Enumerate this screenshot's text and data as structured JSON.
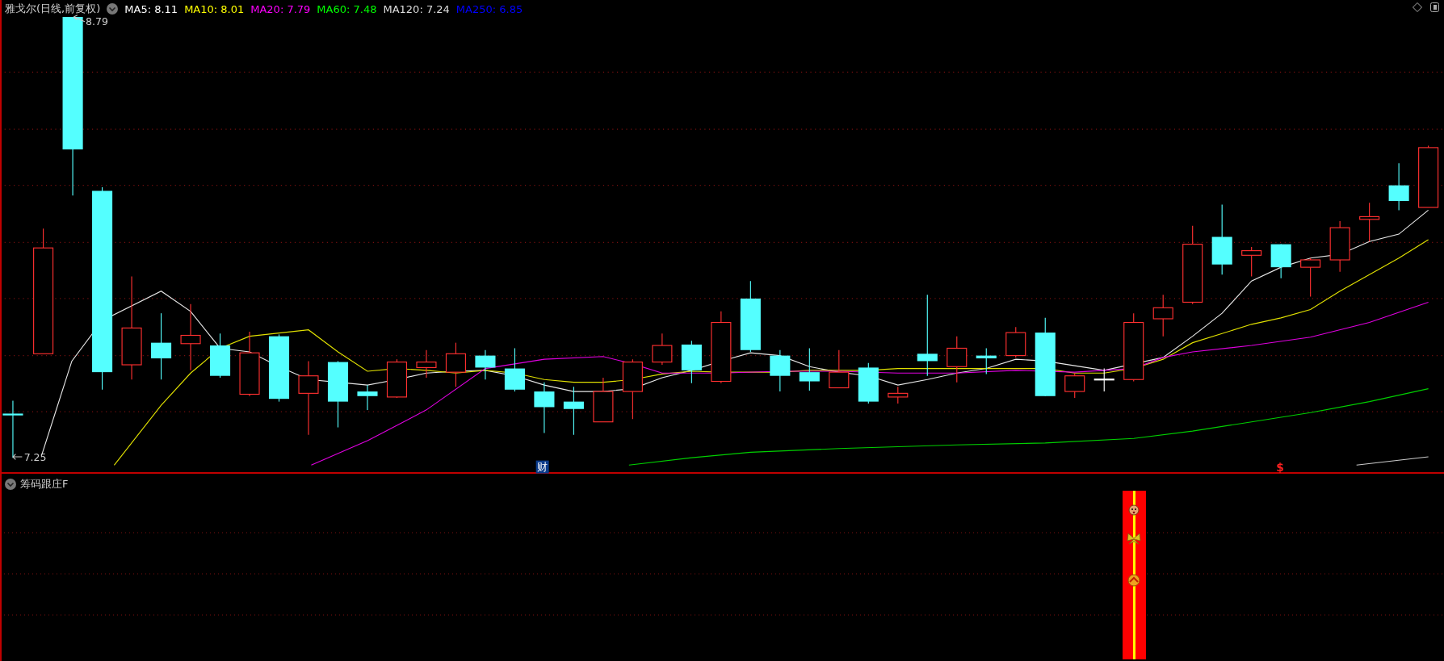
{
  "chart_header": {
    "title": "雅戈尔(日线,前复权)",
    "legend": [
      {
        "label": "MA5: 8.11",
        "color": "#ffffff"
      },
      {
        "label": "MA10: 8.01",
        "color": "#ffff00"
      },
      {
        "label": "MA20: 7.79",
        "color": "#ff00ff"
      },
      {
        "label": "MA60: 7.48",
        "color": "#00ff00"
      },
      {
        "label": "MA120: 7.24",
        "color": "#dddddd"
      },
      {
        "label": "MA250: 6.85",
        "color": "#0000ff"
      }
    ]
  },
  "price_chart": {
    "high_label": "8.79",
    "low_label": "7.25",
    "markers": [
      {
        "kind": "finance",
        "text": "财"
      },
      {
        "kind": "dividend",
        "text": "$"
      }
    ]
  },
  "indicator_panel": {
    "title": "筹码跟庄F"
  }
}
